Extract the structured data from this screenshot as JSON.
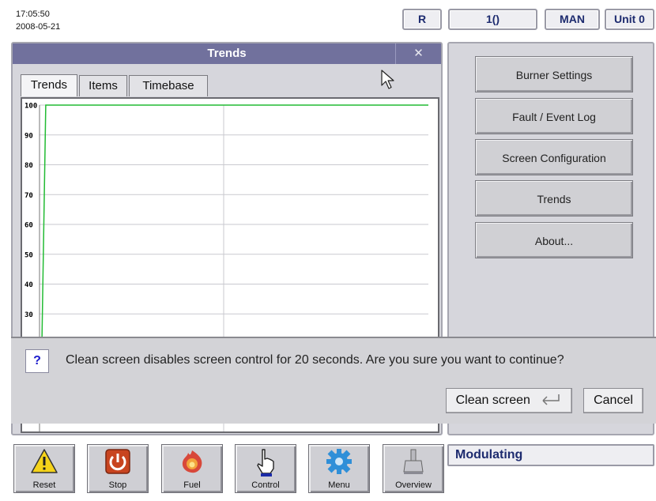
{
  "header": {
    "time": "17:05:50",
    "date": "2008-05-21",
    "indicators": [
      "R",
      "1()",
      "MAN",
      "Unit 0"
    ]
  },
  "trends_window": {
    "title": "Trends",
    "close_glyph": "✕",
    "tabs": [
      "Trends",
      "Items",
      "Timebase"
    ],
    "active_tab": "Trends",
    "y_ticks": [
      "100",
      "90",
      "80",
      "70",
      "60",
      "50",
      "40",
      "30"
    ]
  },
  "chart_data": {
    "type": "line",
    "y_ticks": [
      100,
      90,
      80,
      70,
      60,
      50,
      40,
      30
    ],
    "series": [
      {
        "color": "#22bb33",
        "x": [
          0,
          0.01,
          1
        ],
        "y": [
          20,
          100,
          100
        ]
      }
    ],
    "grid": true,
    "ylim": [
      20,
      100
    ]
  },
  "menu": {
    "buttons": [
      "Burner Settings",
      "Fault / Event Log",
      "Screen Configuration",
      "Trends",
      "About..."
    ]
  },
  "dialog": {
    "icon": "?",
    "message": "Clean screen disables screen control for 20 seconds. Are you sure you want to continue?",
    "confirm_label": "Clean screen",
    "confirm_icon": "enter-arrow-icon",
    "cancel_label": "Cancel"
  },
  "toolbar": {
    "buttons": [
      "Reset",
      "Stop",
      "Fuel",
      "Control",
      "Menu",
      "Overview"
    ]
  },
  "status": {
    "mode": "Modulating"
  },
  "colors": {
    "title_bar": "#71719d",
    "trend_line": "#22bb33",
    "header_text": "#1d2b6f"
  }
}
